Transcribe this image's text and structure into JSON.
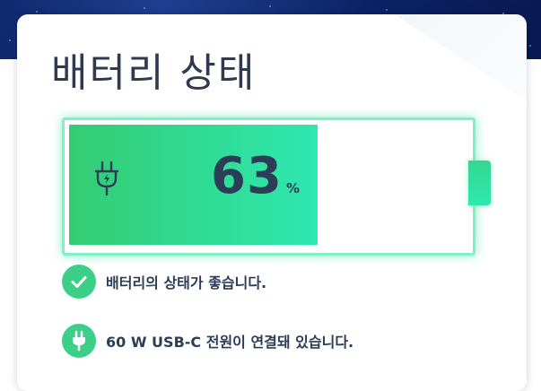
{
  "page": {
    "title": "배터리 상태"
  },
  "battery": {
    "percent": "63",
    "percent_symbol": "%",
    "level": 0.63,
    "fill_color": "#33cc72",
    "fill_color_end": "#2ee8b0",
    "glow_color": "#7ef0c3",
    "charging_icon": "plug-icon"
  },
  "status": [
    {
      "icon": "check-icon",
      "text": "배터리의 상태가 좋습니다."
    },
    {
      "icon": "plug-icon",
      "text": "60 W USB-C 전원이 연결돼 있습니다."
    }
  ],
  "colors": {
    "text": "#2b3d57",
    "accent": "#3ccf87",
    "header_bg": "#0c2266"
  }
}
